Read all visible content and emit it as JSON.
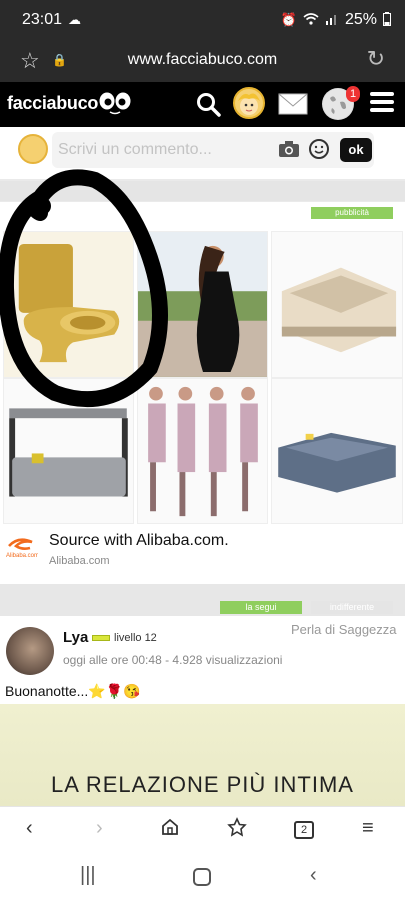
{
  "status": {
    "time": "23:01",
    "battery": "25%"
  },
  "browser": {
    "url": "www.facciabuco.com",
    "tabs_count": "2"
  },
  "site": {
    "logo": "facciabuco",
    "notif_badge": "1"
  },
  "composer": {
    "placeholder": "Scrivi un commento...",
    "ok_label": "ok"
  },
  "ad": {
    "tag": "pubblicità",
    "title": "Source with Alibaba.com.",
    "subtitle": "Alibaba.com"
  },
  "post_actions": {
    "follow": "la segui",
    "ignore": "indifferente"
  },
  "post": {
    "author": "Lya",
    "level": "livello 12",
    "category": "Perla di Saggezza",
    "meta": "oggi alle ore 00:48 - 4.928 visualizzazioni",
    "text": "Buonanotte...⭐🌹😘",
    "image_text": "LA RELAZIONE PIÙ INTIMA"
  },
  "icons": {
    "status": [
      "cloud-icon",
      "alarm-icon",
      "wifi-icon",
      "signal-icon",
      "battery-icon"
    ],
    "browser": [
      "bookmark-star-icon",
      "lock-icon",
      "reload-icon"
    ],
    "header": [
      "search-icon",
      "avatar-icon",
      "mail-icon",
      "globe-icon",
      "menu-icon"
    ]
  }
}
